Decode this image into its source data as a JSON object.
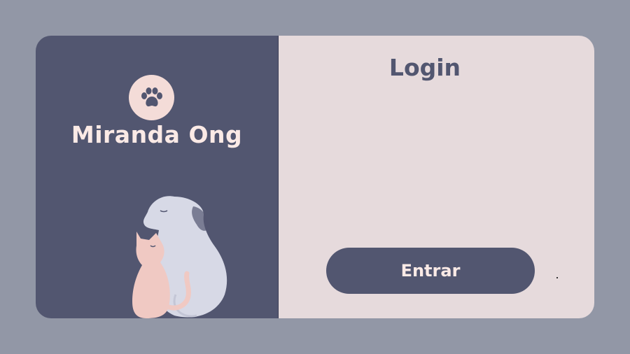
{
  "brand": {
    "name": "Miranda Ong",
    "logo_icon": "paw-icon"
  },
  "login": {
    "title": "Login",
    "submit_label": "Entrar"
  },
  "illustration": {
    "icon": "cat-and-dog-illustration"
  },
  "colors": {
    "page_bg": "#9297a6",
    "panel_dark": "#525670",
    "panel_light": "#e6dadc",
    "accent_pink": "#f4dcd8",
    "cat": "#f0c9c3",
    "dog": "#d7d9e6"
  }
}
